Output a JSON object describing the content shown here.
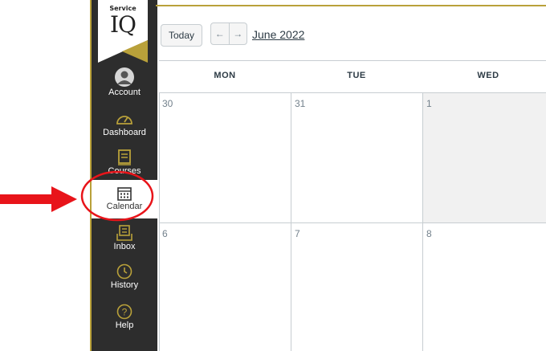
{
  "nav": {
    "logo": {
      "line1": "Service",
      "line2": "IQ"
    },
    "items": [
      {
        "label": "Account",
        "icon": "account-icon"
      },
      {
        "label": "Dashboard",
        "icon": "dashboard-icon"
      },
      {
        "label": "Courses",
        "icon": "courses-icon"
      },
      {
        "label": "Calendar",
        "icon": "calendar-icon",
        "active": true
      },
      {
        "label": "Inbox",
        "icon": "inbox-icon"
      },
      {
        "label": "History",
        "icon": "history-icon"
      },
      {
        "label": "Help",
        "icon": "help-icon"
      }
    ]
  },
  "toolbar": {
    "today_label": "Today",
    "prev_label": "←",
    "next_label": "→",
    "month_label": "June 2022"
  },
  "calendar": {
    "days": [
      "MON",
      "TUE",
      "WED"
    ],
    "weeks": [
      [
        "30",
        "31",
        "1"
      ],
      [
        "6",
        "7",
        "8"
      ]
    ]
  },
  "colors": {
    "nav_bg": "#2d2d2d",
    "accent_gold": "#b9a13a",
    "annotation_red": "#e8141a",
    "today_bg": "#f1f1f1"
  }
}
